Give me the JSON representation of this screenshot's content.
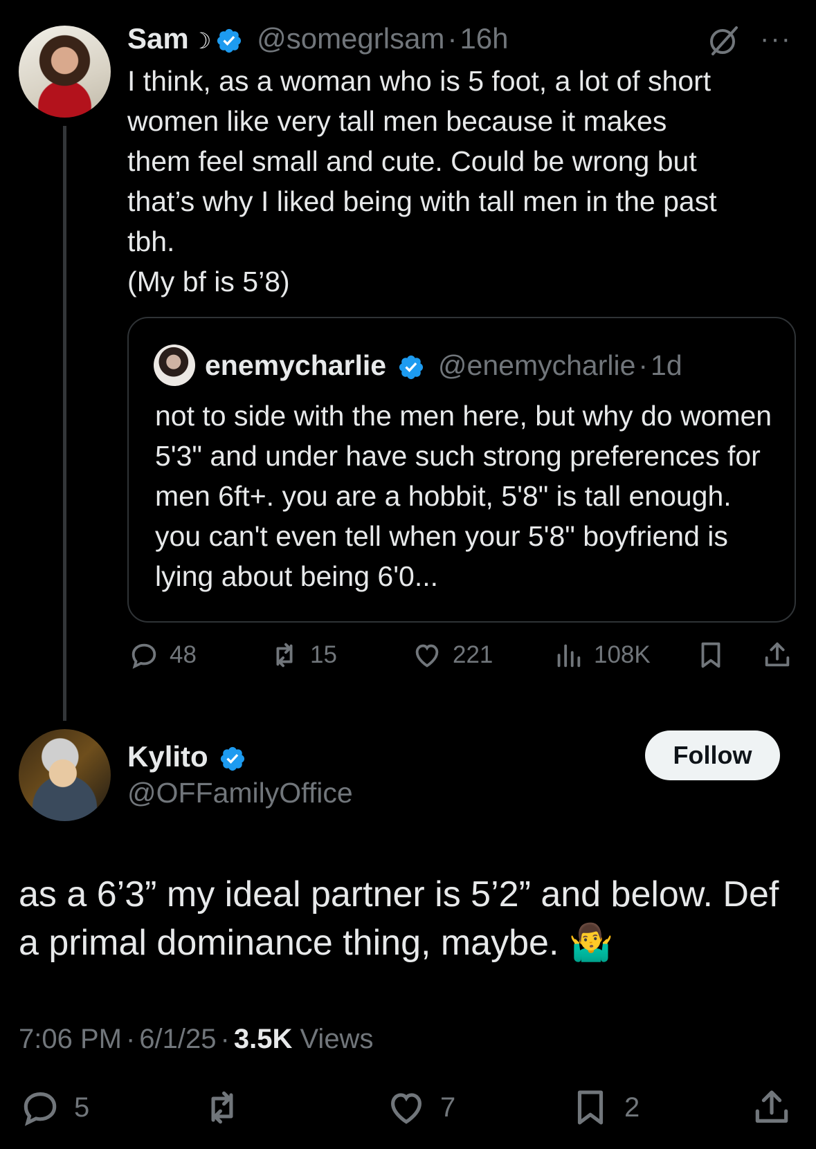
{
  "colors": {
    "background": "#000000",
    "text": "#e7e9ea",
    "muted": "#71767b",
    "verified": "#1d9bf0",
    "border": "#2f3336"
  },
  "parent_tweet": {
    "name": "Sam",
    "name_suffix": "☽",
    "handle": "@somegrlsam",
    "separator": "·",
    "time": "16h",
    "text": "I think, as a woman who is 5 foot, a lot of short\nwomen like very tall men because it makes\nthem feel small and cute. Could be wrong but\nthat’s why I liked being with tall men in the past\ntbh.\n(My bf is 5’8)",
    "quote": {
      "name": "enemycharlie",
      "handle": "@enemycharlie",
      "separator": "·",
      "time": "1d",
      "text": "not to side with the men here, but why do women 5'3\" and under have such strong preferences for men 6ft+. you are a hobbit, 5'8\" is tall enough. you can't even tell when your 5'8\" boyfriend is lying about being 6'0..."
    },
    "actions": {
      "replies": "48",
      "reposts": "15",
      "likes": "221",
      "views": "108K"
    }
  },
  "main_tweet": {
    "name": "Kylito",
    "handle": "@OFFamilyOffice",
    "follow_label": "Follow",
    "text": "as a 6’3” my ideal partner is 5’2” and below. Def a primal dominance thing, maybe. 🤷‍♂️",
    "time": "7:06 PM",
    "date": "6/1/25",
    "separator": "·",
    "views_count": "3.5K",
    "views_label": "Views",
    "actions": {
      "replies": "5",
      "reposts": "",
      "likes": "7",
      "bookmarks": "2"
    }
  }
}
